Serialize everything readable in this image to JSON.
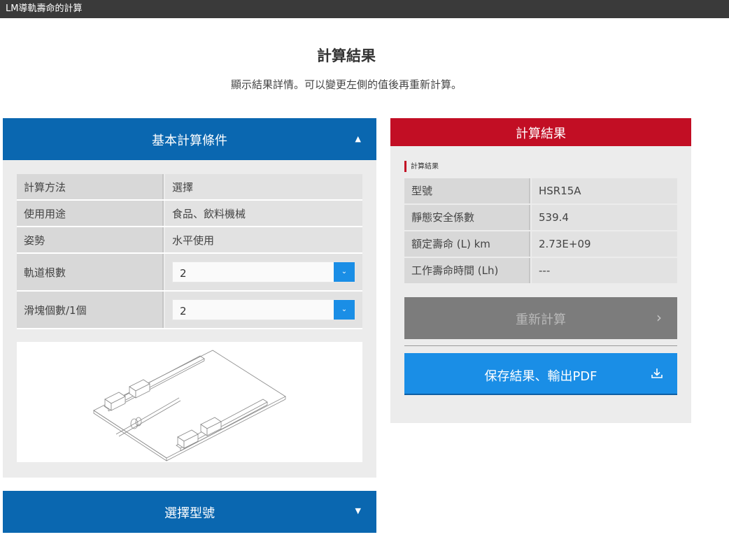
{
  "window": {
    "title": "LM導軌壽命的計算"
  },
  "page": {
    "title": "計算結果",
    "subtitle": "顯示結果詳情。可以變更左側的值後再重新計算。"
  },
  "conditions_panel": {
    "title": "基本計算條件",
    "caret": "▲",
    "rows": [
      {
        "label": "計算方法",
        "value": "選擇"
      },
      {
        "label": "使用用途",
        "value": "食品、飲料機械"
      },
      {
        "label": "姿勢",
        "value": "水平使用"
      },
      {
        "label": "軌道根數",
        "value": "2"
      },
      {
        "label": "滑塊個數/1個",
        "value": "2"
      }
    ],
    "select_arrow": "⌄"
  },
  "model_panel": {
    "title": "選擇型號",
    "caret": "▼"
  },
  "results_panel": {
    "title": "計算結果",
    "caption": "計算結果",
    "rows": [
      {
        "label": "型號",
        "value": "HSR15A"
      },
      {
        "label": "靜態安全係數",
        "value": "539.4"
      },
      {
        "label": "額定壽命 (L) km",
        "value": "2.73E+09"
      },
      {
        "label": "工作壽命時間 (Lh)",
        "value": "---"
      }
    ],
    "recalc_label": "重新計算",
    "recalc_icon": "chevron-right-icon",
    "save_label": "保存結果、輸出PDF",
    "save_icon": "download-icon"
  },
  "colors": {
    "primary_blue": "#0a67b0",
    "accent_blue": "#1a8ee6",
    "result_red": "#c20e24",
    "disabled_gray": "#7c7c7c"
  }
}
